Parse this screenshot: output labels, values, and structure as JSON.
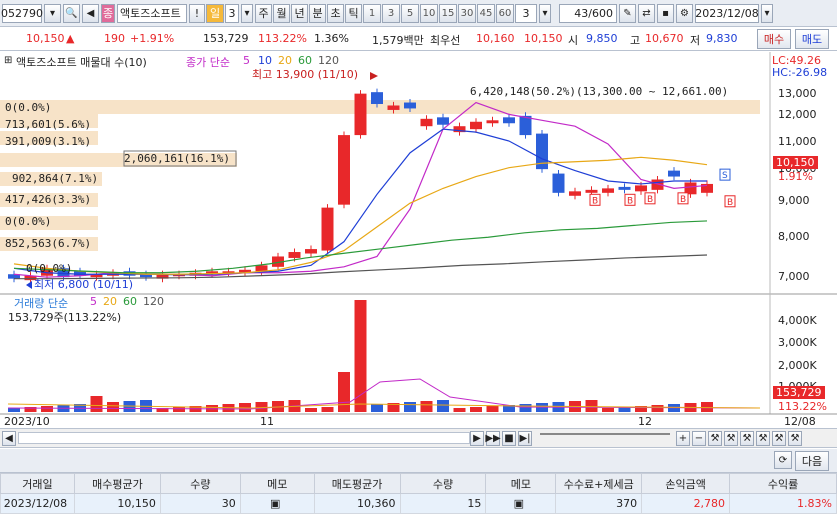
{
  "toolbar": {
    "code": "052790",
    "name": "액토즈소프트",
    "badge": "종",
    "excl": "!",
    "period_tab": "일",
    "count": "3",
    "periods": [
      "주",
      "월",
      "년",
      "분",
      "초",
      "틱"
    ],
    "minutes": [
      "1",
      "3",
      "5",
      "10",
      "15",
      "30",
      "45",
      "60"
    ],
    "interval": "3",
    "page_count": "43/600",
    "date": "2023/12/08"
  },
  "quote": {
    "price": "10,150",
    "change": "190",
    "change_pct": "+1.91%",
    "volume": "153,729",
    "vol_ratio": "113.22%",
    "turnover": "1.36%",
    "amount": "1,579백만",
    "best_label": "최우선",
    "ask": "10,160",
    "bid": "10,150",
    "open_label": "시",
    "open": "9,850",
    "high_label": "고",
    "high": "10,670",
    "low_label": "저",
    "low": "9,830",
    "buy_btn": "매수",
    "sell_btn": "매도"
  },
  "price_panel": {
    "title": "액토즈소프트 매물대 수(10)",
    "ma_label": "종가 단순",
    "ma_periods": [
      "5",
      "10",
      "20",
      "60",
      "120"
    ],
    "lc": "LC:49.26",
    "hc": "HC:-26.98",
    "high_note": "최고 13,900 (11/10)",
    "low_note": "최저 6,800 (10/11)",
    "current": "10,150",
    "current_pct": "1.91%",
    "range_label": "6,420,148(50.2%)(13,300.00 ~ 12,661.00)",
    "profile": [
      "0(0.0%)",
      "713,601(5.6%)",
      "391,009(3.1%)",
      "2,060,161(16.1%)",
      "902,864(7.1%)",
      "417,426(3.3%)",
      "0(0.0%)",
      "852,563(6.7%)",
      "0(0.0%)"
    ],
    "y_ticks": [
      "13,000",
      "12,000",
      "11,000",
      "10,000",
      "9,000",
      "8,000",
      "7,000"
    ],
    "signals": [
      "S",
      "B"
    ]
  },
  "volume_panel": {
    "title": "거래량 단순",
    "ma_periods": [
      "5",
      "20",
      "60",
      "120"
    ],
    "volume_text": "153,729주(113.22%)",
    "y_ticks": [
      "4,000K",
      "3,000K",
      "2,000K",
      "1,000K"
    ],
    "current": "153,729",
    "current_pct": "113.22%"
  },
  "x_axis": [
    "2023/10",
    "11",
    "12",
    "12/08"
  ],
  "bottom": {
    "refresh_btn": "⟳",
    "next_btn": "다음"
  },
  "table": {
    "headers": [
      "거래일",
      "매수평균가",
      "수량",
      "메모",
      "매도평균가",
      "수량",
      "메모",
      "수수료+제세금",
      "손익금액",
      "수익률"
    ],
    "row": [
      "2023/12/08",
      "10,150",
      "30",
      "",
      "10,360",
      "15",
      "",
      "370",
      "2,780",
      "1.83%"
    ]
  },
  "colors": {
    "up": "#e8282a",
    "down": "#2b5fd9",
    "ma5": "#c22ac8",
    "ma10": "#1f3fd6",
    "ma20": "#e8a816",
    "ma60": "#2a9a3a",
    "ma120": "#555555",
    "profile": "#f7e3c8"
  },
  "chart_data": {
    "type": "candlestick",
    "x_range": [
      "2023/10",
      "2023/12/08"
    ],
    "y_range": [
      6800,
      13900
    ],
    "candles": [
      [
        7150,
        7350,
        6900,
        6850
      ],
      [
        7300,
        7200,
        6950,
        6900
      ],
      [
        7100,
        7300,
        6900,
        6900
      ],
      [
        7250,
        7300,
        7000,
        6950
      ],
      [
        7100,
        7050,
        7000,
        6950
      ]
    ]
  }
}
